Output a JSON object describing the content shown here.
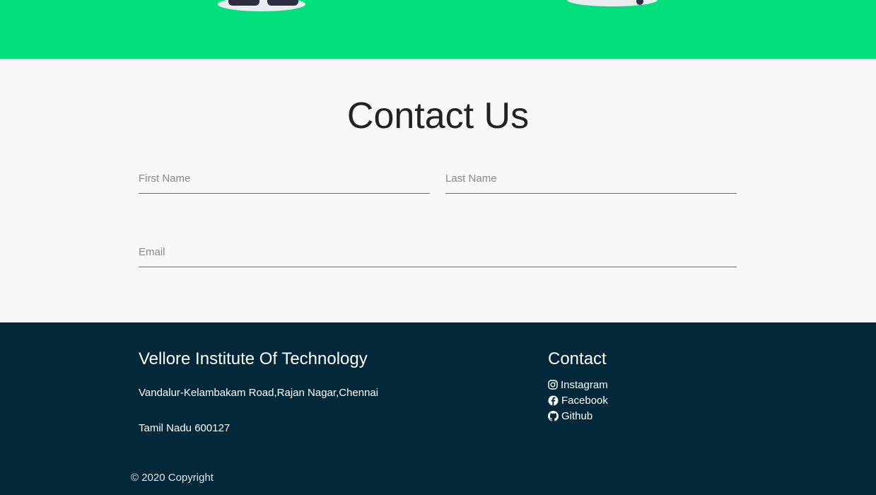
{
  "contact": {
    "title": "Contact Us",
    "first_name_placeholder": "First Name",
    "last_name_placeholder": "Last Name",
    "email_placeholder": "Email"
  },
  "footer": {
    "institute_title": "Vellore Institute Of Technology",
    "address_line1": "Vandalur-Kelambakam Road,Rajan Nagar,Chennai",
    "address_line2": "Tamil Nadu 600127",
    "contact_title": "Contact",
    "links": [
      {
        "label": "Instagram",
        "icon": "instagram-icon"
      },
      {
        "label": "Facebook",
        "icon": "facebook-icon"
      },
      {
        "label": "Github",
        "icon": "github-icon"
      }
    ],
    "copyright": "© 2020 Copyright"
  },
  "colors": {
    "hero_green": "#00df7c",
    "footer_bg": "#02283a",
    "page_bg": "#f8f8f8"
  }
}
